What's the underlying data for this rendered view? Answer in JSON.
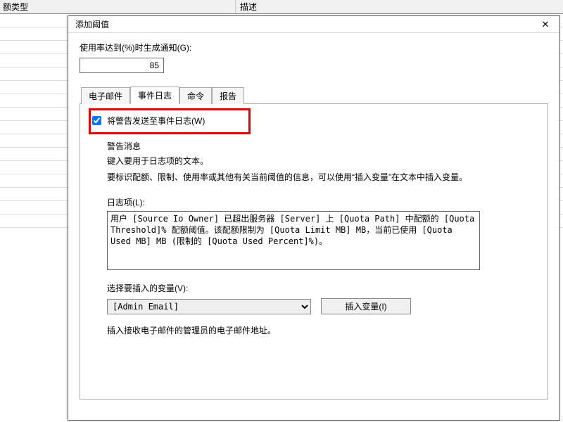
{
  "bg": {
    "col1": "额类型",
    "col2": "描述"
  },
  "dialog": {
    "title": "添加阈值",
    "close": "✕",
    "usageLabel": "使用率达到(%)时生成通知(G):",
    "usageValue": "85",
    "tabs": {
      "email": "电子邮件",
      "eventlog": "事件日志",
      "command": "命令",
      "report": "报告"
    },
    "checkboxLabel": "将警告发送至事件日志(W)",
    "msgGroup": "警告消息",
    "msgDesc1": "键入要用于日志项的文本。",
    "msgDesc2": "要标识配额、限制、使用率或其他有关当前阈值的信息，可以使用“插入变量”在文本中插入变量。",
    "logLabel": "日志项(L):",
    "logText": "用户 [Source Io Owner] 已超出服务器 [Server] 上 [Quota Path] 中配额的 [Quota Threshold]% 配额阈值。该配额限制为 [Quota Limit MB] MB，当前已使用 [Quota Used MB] MB (限制的 [Quota Used Percent]%)。",
    "selectLabel": "选择要插入的变量(V):",
    "selectValue": "[Admin Email]",
    "insertBtn": "插入变量(I)",
    "hint": "插入接收电子邮件的管理员的电子邮件地址。"
  }
}
